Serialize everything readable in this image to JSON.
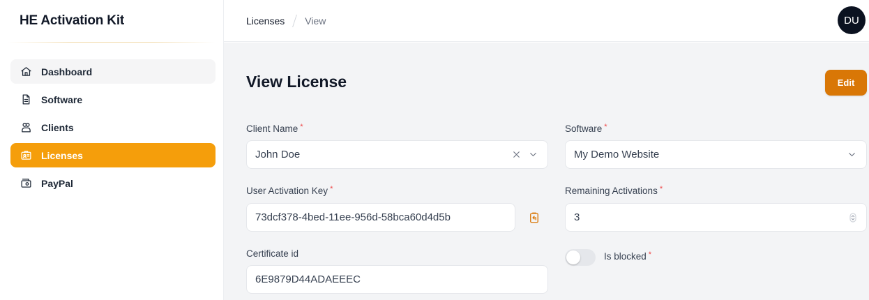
{
  "app": {
    "title": "HE Activation Kit"
  },
  "sidebar": {
    "items": [
      {
        "label": "Dashboard",
        "icon": "home-icon",
        "state": "hover"
      },
      {
        "label": "Software",
        "icon": "document-icon",
        "state": "normal"
      },
      {
        "label": "Clients",
        "icon": "users-icon",
        "state": "normal"
      },
      {
        "label": "Licenses",
        "icon": "license-icon",
        "state": "active"
      },
      {
        "label": "PayPal",
        "icon": "wallet-icon",
        "state": "normal"
      }
    ]
  },
  "header": {
    "breadcrumb": [
      "Licenses",
      "View"
    ],
    "avatar_initials": "DU"
  },
  "page": {
    "title": "View License",
    "edit_label": "Edit"
  },
  "form": {
    "client_name": {
      "label": "Client Name",
      "required_mark": "*",
      "value": "John Doe"
    },
    "software": {
      "label": "Software",
      "required_mark": "*",
      "value": "My Demo Website"
    },
    "user_activation_key": {
      "label": "User Activation Key",
      "required_mark": "*",
      "value": "73dcf378-4bed-11ee-956d-58bca60d4d5b"
    },
    "remaining_activations": {
      "label": "Remaining Activations",
      "required_mark": "*",
      "value": "3"
    },
    "certificate_id": {
      "label": "Certificate id",
      "value": "6E9879D44ADAEEEC"
    },
    "is_blocked": {
      "label": "Is blocked",
      "required_mark": "*",
      "checked": false
    }
  },
  "colors": {
    "accent": "#f59e0b",
    "edit_button": "#d97706",
    "required": "#ef4444",
    "avatar_bg": "#0b1220"
  }
}
